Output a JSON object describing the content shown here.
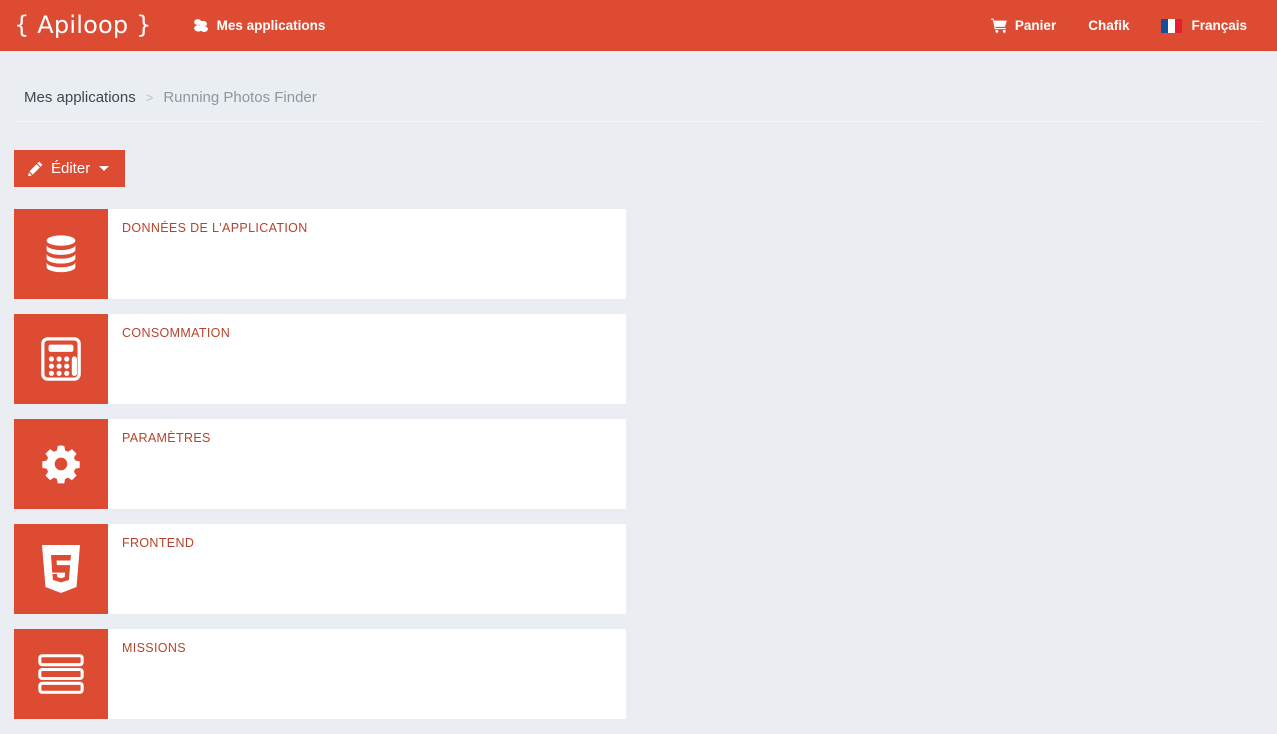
{
  "header": {
    "brand": "{ Apiloop }",
    "left_items": [
      {
        "label": "Mes applications",
        "icon": "cubes-icon"
      }
    ],
    "right_items": [
      {
        "label": "Panier",
        "icon": "shopping-cart-icon"
      },
      {
        "label": "Chafik",
        "icon": ""
      },
      {
        "label": "Français",
        "icon": "french-flag-icon"
      }
    ]
  },
  "breadcrumb": {
    "parent": "Mes applications",
    "separator": ">",
    "current": "Running Photos Finder"
  },
  "toolbar": {
    "edit_label": "Éditer",
    "edit_icon": "pencil-icon",
    "caret_icon": "caret-down-icon"
  },
  "cards": {
    "left": [
      {
        "title": "DONNÉES DE L'APPLICATION",
        "icon": "database-icon"
      },
      {
        "title": "CONSOMMATION",
        "icon": "calculator-icon"
      },
      {
        "title": "PARAMÈTRES",
        "icon": "gear-icon"
      }
    ],
    "right": [
      {
        "title": "FRONTEND",
        "icon": "html5-icon"
      },
      {
        "title": "MISSIONS",
        "icon": "tasks-icon"
      }
    ]
  },
  "colors": {
    "brand_red": "#dd4b33",
    "page_background": "#eaeef2",
    "card_background": "#ffffff",
    "card_title": "#b5432e",
    "breadcrumb_active": "#3f4652",
    "breadcrumb_current": "#8d96a1"
  }
}
